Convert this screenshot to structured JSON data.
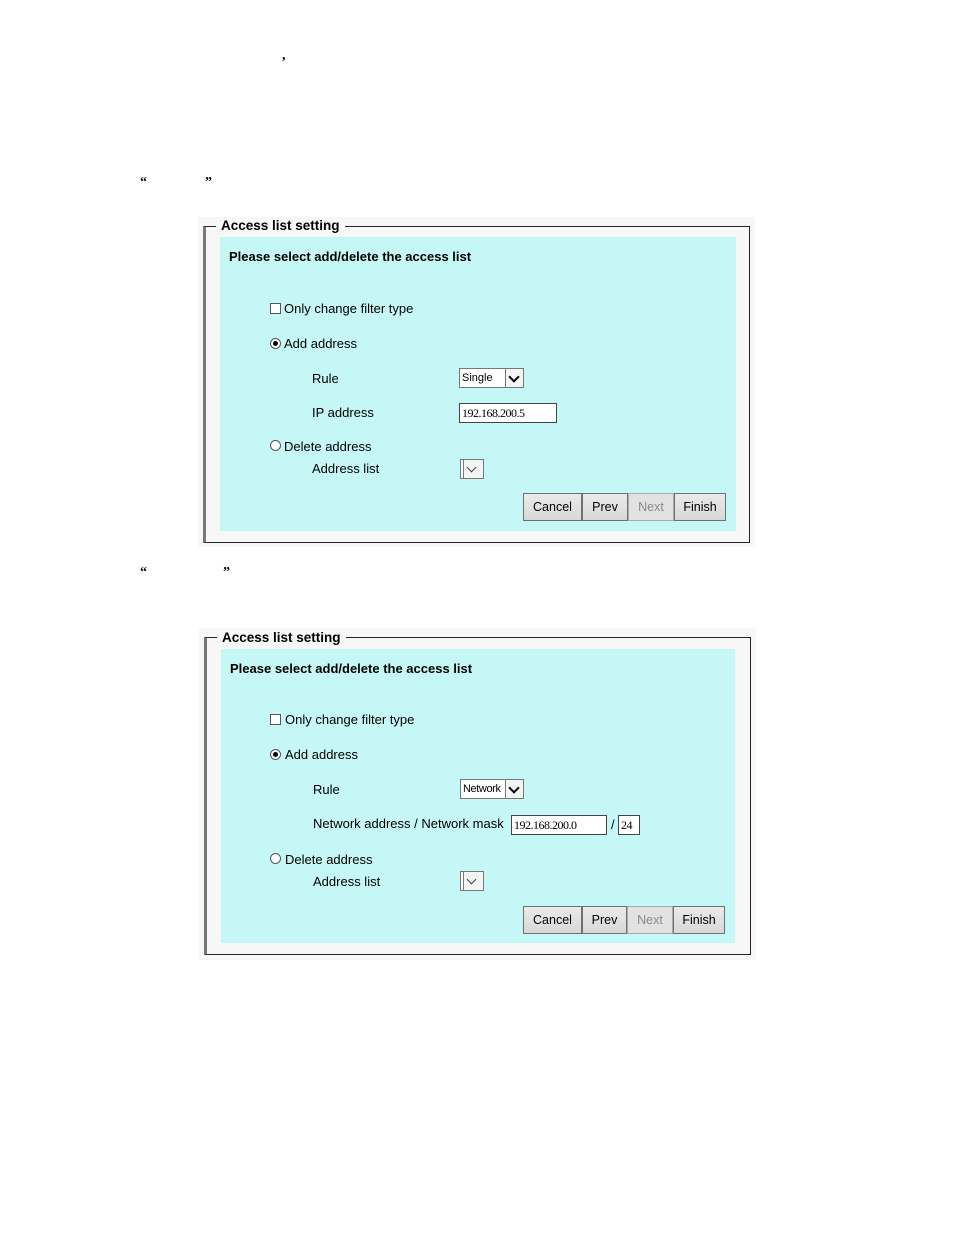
{
  "document": {
    "stray_comma": ",",
    "quote_open_1": "“",
    "quote_close_1": "”",
    "quote_open_2": "“",
    "quote_close_2": "”"
  },
  "panels": [
    {
      "legend": "Access list setting",
      "instruction": "Please select add/delete the access list",
      "only_change_filter_type": {
        "label": "Only change filter type",
        "checked": false
      },
      "add_address": {
        "label": "Add address",
        "selected": true
      },
      "rule": {
        "label": "Rule",
        "value": "Single"
      },
      "address_field": {
        "label": "IP address",
        "value": "192.168.200.5"
      },
      "delete_address": {
        "label": "Delete address",
        "selected": false
      },
      "address_list": {
        "label": "Address list",
        "value": ""
      },
      "buttons": {
        "cancel": "Cancel",
        "prev": "Prev",
        "next": "Next",
        "finish": "Finish"
      }
    },
    {
      "legend": "Access list setting",
      "instruction": "Please select add/delete the access list",
      "only_change_filter_type": {
        "label": "Only change filter type",
        "checked": false
      },
      "add_address": {
        "label": "Add address",
        "selected": true
      },
      "rule": {
        "label": "Rule",
        "value": "Network"
      },
      "address_field": {
        "label": "Network address / Network mask",
        "value": "192.168.200.0",
        "separator": "/",
        "mask": "24"
      },
      "delete_address": {
        "label": "Delete address",
        "selected": false
      },
      "address_list": {
        "label": "Address list",
        "value": ""
      },
      "buttons": {
        "cancel": "Cancel",
        "prev": "Prev",
        "next": "Next",
        "finish": "Finish"
      }
    }
  ],
  "colors": {
    "panel_background": "#c6f7f7",
    "outer_background": "#f7f7f7"
  }
}
